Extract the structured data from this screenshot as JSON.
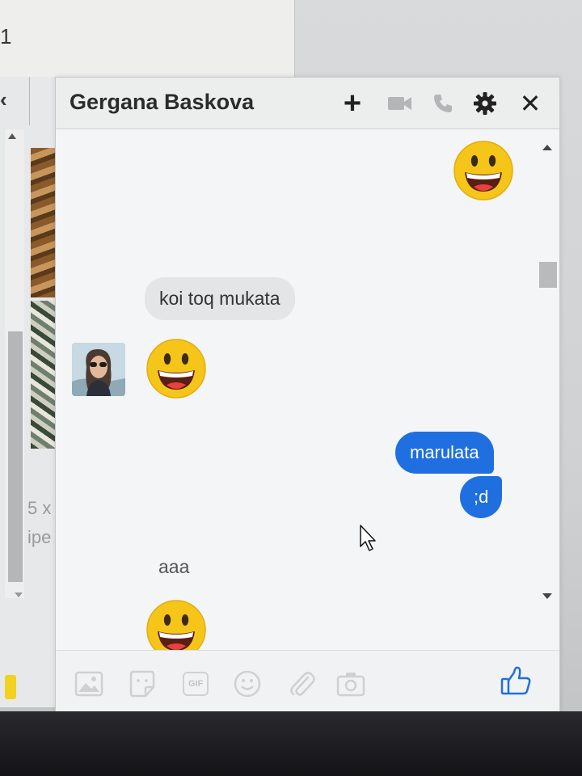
{
  "background": {
    "top_window_fragment": "1",
    "side_text_lines": [
      "5 x",
      "ipe"
    ]
  },
  "chat": {
    "title": "Gergana Baskova",
    "header_icons": [
      "plus-icon",
      "video-camera-icon",
      "phone-icon",
      "gear-icon",
      "close-icon"
    ],
    "plus_label": "+",
    "close_label": "✕",
    "messages": [
      {
        "from": "me",
        "type": "emoji",
        "emoji": "grinning-face"
      },
      {
        "from": "contact",
        "type": "text",
        "text": "koi toq mukata"
      },
      {
        "from": "contact",
        "type": "emoji",
        "emoji": "grinning-face"
      },
      {
        "from": "me",
        "type": "text",
        "text": "marulata"
      },
      {
        "from": "me",
        "type": "text",
        "text": ";d"
      },
      {
        "from": "contact",
        "type": "text",
        "text": "aaa"
      },
      {
        "from": "contact",
        "type": "emoji",
        "emoji": "grinning-face"
      }
    ],
    "footer_icons": [
      "photo-icon",
      "sticker-icon",
      "gif-icon",
      "emoji-icon",
      "attach-icon",
      "camera-icon",
      "like-icon"
    ],
    "gif_label": "GIF"
  },
  "colors": {
    "outgoing_bubble": "#1f6fe0",
    "incoming_bubble": "#e4e5e6",
    "like_icon": "#1f6fe0",
    "emoji_face": "#f6c51a"
  }
}
